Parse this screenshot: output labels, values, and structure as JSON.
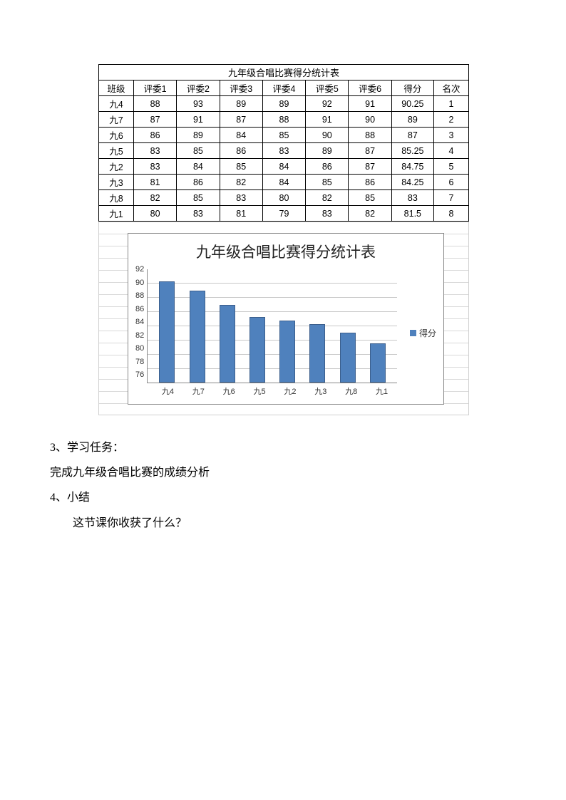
{
  "table": {
    "title": "九年级合唱比赛得分统计表",
    "headers": [
      "班级",
      "评委1",
      "评委2",
      "评委3",
      "评委4",
      "评委5",
      "评委6",
      "得分",
      "名次"
    ],
    "rows": [
      [
        "九4",
        "88",
        "93",
        "89",
        "89",
        "92",
        "91",
        "90.25",
        "1"
      ],
      [
        "九7",
        "87",
        "91",
        "87",
        "88",
        "91",
        "90",
        "89",
        "2"
      ],
      [
        "九6",
        "86",
        "89",
        "84",
        "85",
        "90",
        "88",
        "87",
        "3"
      ],
      [
        "九5",
        "83",
        "85",
        "86",
        "83",
        "89",
        "87",
        "85.25",
        "4"
      ],
      [
        "九2",
        "83",
        "84",
        "85",
        "84",
        "86",
        "87",
        "84.75",
        "5"
      ],
      [
        "九3",
        "81",
        "86",
        "82",
        "84",
        "85",
        "86",
        "84.25",
        "6"
      ],
      [
        "九8",
        "82",
        "85",
        "83",
        "80",
        "82",
        "85",
        "83",
        "7"
      ],
      [
        "九1",
        "80",
        "83",
        "81",
        "79",
        "83",
        "82",
        "81.5",
        "8"
      ]
    ]
  },
  "chart_data": {
    "type": "bar",
    "title": "九年级合唱比赛得分统计表",
    "categories": [
      "九4",
      "九7",
      "九6",
      "九5",
      "九2",
      "九3",
      "九8",
      "九1"
    ],
    "series": [
      {
        "name": "得分",
        "values": [
          90.25,
          89,
          87,
          85.25,
          84.75,
          84.25,
          83,
          81.5
        ]
      }
    ],
    "ylim": [
      76,
      92
    ],
    "yticks": [
      92,
      90,
      88,
      86,
      84,
      82,
      80,
      78,
      76
    ],
    "xlabel": "",
    "ylabel": "",
    "legend_position": "right",
    "legend_label": "得分"
  },
  "text": {
    "p1": "3、学习任务：",
    "p2": "完成九年级合唱比赛的成绩分析",
    "p3": "4、小结",
    "p4": "这节课你收获了什么？"
  }
}
